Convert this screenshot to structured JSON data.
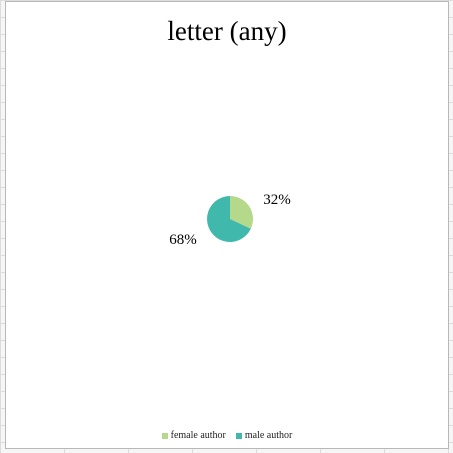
{
  "chart_data": {
    "type": "pie",
    "title": "letter (any)",
    "slices": [
      {
        "name": "female author",
        "value": 32,
        "label": "32%",
        "color": "#b4d98a"
      },
      {
        "name": "male author",
        "value": 68,
        "label": "68%",
        "color": "#40b8ac"
      }
    ],
    "legend_position": "bottom"
  }
}
